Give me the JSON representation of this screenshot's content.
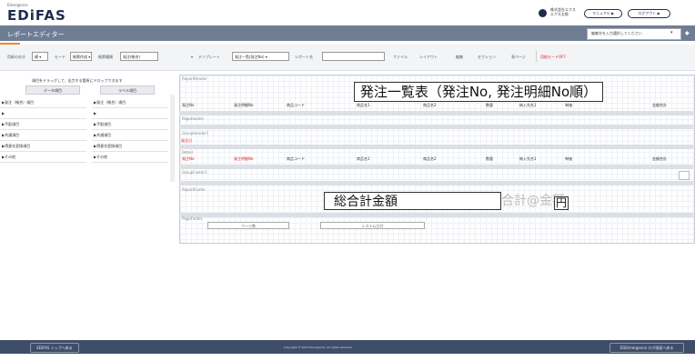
{
  "header": {
    "logo_sub": "Emergence",
    "logo": "EDiFAS",
    "company_line1": "株式会社エクス",
    "company_line2": "エクス太郎",
    "btn1": "マニュアル ▶",
    "btn2": "ログアウト ▶"
  },
  "titlebar": {
    "title": "レポートエディター",
    "select_placeholder": "編集先を入力選択してください",
    "caret": "▾",
    "menu": "◆"
  },
  "toolbar": {
    "use_width_label": "用紙の向き",
    "use_width_value": "横 ▾",
    "mode_label": "モード",
    "mode_value": "帳票作成 ▾",
    "category_label": "帳票種類",
    "category_value": "発注(帳合)",
    "category_caret": "▾",
    "template_label": "テンプレート",
    "template_value": "発注一覧(発注No) ▾",
    "report_name_label": "レポート名",
    "report_name_value": "",
    "menu_file": "ファイル",
    "menu_layout": "レイアウト",
    "menu_edit": "編集",
    "menu_section": "セクション",
    "menu_page": "表ページ",
    "toggle_label": "用紙モードOFF"
  },
  "left_panel": {
    "instruction": "項目をドラッグして、出力する箇所にドロップできます",
    "data_header": "データ項目",
    "label_header": "ラベル項目",
    "data_items": [
      "▶発注（帳合）項目",
      "▶",
      "▶手配項目",
      "▶共通項目",
      "▶得意先変換項目",
      "▶その他"
    ],
    "label_items": [
      "▶発注（帳合）項目",
      "▶",
      "▶手配項目",
      "▶共通項目",
      "▶得意先変換項目",
      "▶その他"
    ]
  },
  "canvas": {
    "band_report_header": "ReportHeader",
    "report_title": "発注一覧表（発注No, 発注明細No順）",
    "band_page_header": "PageHeader",
    "band_group_header": "GroupHeader1",
    "group_red_label": "発注日",
    "band_detail": "Detail",
    "band_group_footer": "GroupFooter1",
    "band_report_footer": "ReportFooter",
    "band_page_footer": "PageFooter",
    "header_columns": [
      "発注No",
      "発注明細No",
      "商品コード",
      "商品名1",
      "商品名2",
      "数量",
      "納入先名1",
      "単価",
      "",
      "金額合計"
    ],
    "detail_columns": [
      "発注No",
      "発注明細No",
      "商品コード",
      "商品名1",
      "商品名2",
      "数量",
      "納入先名1",
      "単価",
      "",
      "金額合計"
    ],
    "total_label": "総合計金額",
    "total_value": "合計@金額",
    "total_yen": "円",
    "footer_page": "ページ数",
    "footer_date": "システム日付"
  },
  "bottombar": {
    "left_button": "EDiFAS トップへ戻る",
    "copyright": "Copyright © 2015 Emergence. All rights reserved.",
    "right_button": "EDiEmergence ログ画面へ戻る"
  }
}
